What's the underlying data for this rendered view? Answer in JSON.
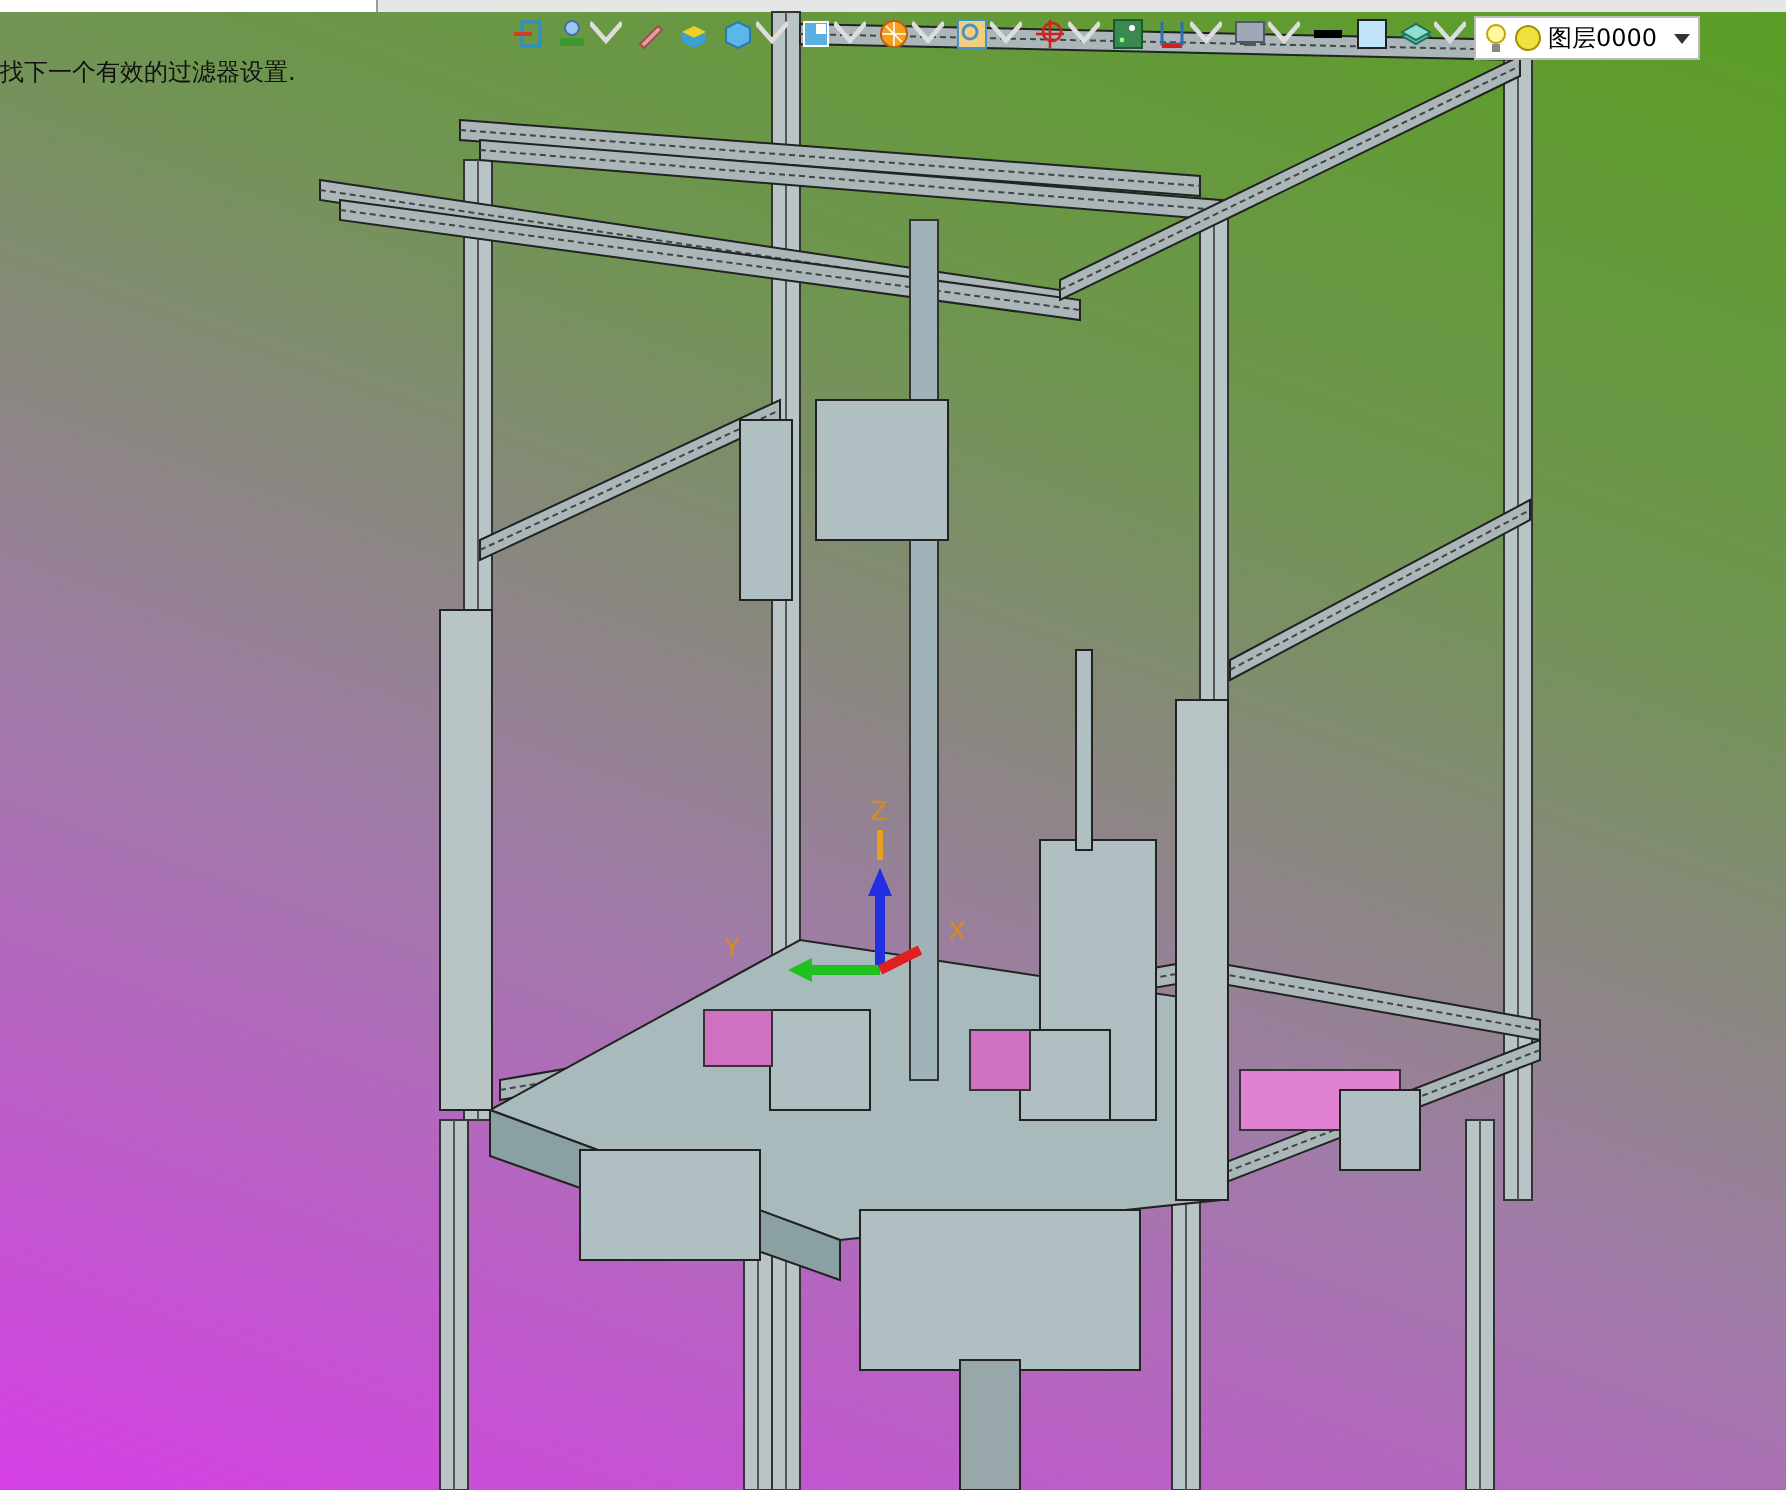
{
  "status_message": "找下一个有效的过滤器设置.",
  "toolbar": [
    {
      "kind": "exit",
      "dropdown": false
    },
    {
      "kind": "lamp",
      "dropdown": true
    },
    {
      "kind": "pencil",
      "dropdown": false
    },
    {
      "kind": "cube-top",
      "dropdown": false
    },
    {
      "kind": "cube",
      "dropdown": true
    },
    {
      "kind": "view",
      "dropdown": true
    },
    {
      "kind": "sphere",
      "dropdown": true
    },
    {
      "kind": "zoom",
      "dropdown": true
    },
    {
      "kind": "target",
      "dropdown": true
    },
    {
      "kind": "snap",
      "dropdown": false
    },
    {
      "kind": "bracket",
      "dropdown": true
    },
    {
      "kind": "monitor",
      "dropdown": true
    },
    {
      "kind": "line",
      "dropdown": false
    },
    {
      "kind": "square",
      "dropdown": false
    },
    {
      "kind": "layers",
      "dropdown": true
    }
  ],
  "layer_dropdown": {
    "value": "图层0000"
  },
  "axes": [
    {
      "label": "Z"
    },
    {
      "label": "Y"
    },
    {
      "label": "X"
    }
  ]
}
